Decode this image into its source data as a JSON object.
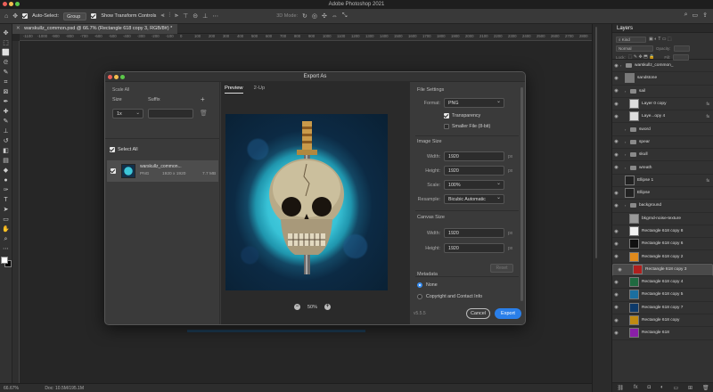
{
  "window_title": "Adobe Photoshop 2021",
  "options_bar": {
    "auto_select_label": "Auto-Select:",
    "auto_select_value": "Group",
    "transform_label": "Show Transform Controls",
    "mode_3d": "3D Mode:"
  },
  "document_tab": "warskullz_common.psd @ 66.7% (Rectangle 618 copy 3, RGB/8#) *",
  "ruler_ticks": [
    "-1100",
    "-1000",
    "-900",
    "-800",
    "-700",
    "-600",
    "-500",
    "-400",
    "-300",
    "-200",
    "-100",
    "0",
    "100",
    "200",
    "300",
    "400",
    "500",
    "600",
    "700",
    "800",
    "900",
    "1000",
    "1100",
    "1200",
    "1300",
    "1400",
    "1500",
    "1600",
    "1700",
    "1800",
    "1900",
    "2000",
    "2100",
    "2200",
    "2300",
    "2400",
    "2500",
    "2600",
    "2700",
    "2800",
    "2900",
    "3000"
  ],
  "status": {
    "zoom": "66.67%",
    "doc": "Doc: 10.5M/195.1M"
  },
  "dialog": {
    "title": "Export As",
    "scale_all": "Scale All",
    "size_header": "Size",
    "suffix_header": "Suffix",
    "scale_value": "1x",
    "select_all": "Select All",
    "asset": {
      "name": "warskullz_common...",
      "format": "PNG",
      "dimensions": "1920 x 1920",
      "filesize": "7.7 MB"
    },
    "tabs": [
      "Preview",
      "2-Up"
    ],
    "zoom": "50%",
    "file_settings": {
      "section": "File Settings",
      "format_label": "Format:",
      "format_value": "PNG",
      "transparency": "Transparency",
      "smaller_file": "Smaller File (8-bit)"
    },
    "image_size": {
      "section": "Image Size",
      "width_label": "Width:",
      "width_value": "1920",
      "height_label": "Height:",
      "height_value": "1920",
      "scale_label": "Scale:",
      "scale_value": "100%",
      "resample_label": "Resample:",
      "resample_value": "Bicubic Automatic",
      "unit": "px"
    },
    "canvas_size": {
      "section": "Canvas Size",
      "width_label": "Width:",
      "width_value": "1920",
      "height_label": "Height:",
      "height_value": "1920",
      "unit": "px",
      "reset": "Reset"
    },
    "metadata": {
      "section": "Metadata",
      "none": "None",
      "copyright": "Copyright and Contact Info"
    },
    "version": "v5.5.5",
    "cancel": "Cancel",
    "export": "Export"
  },
  "layers": {
    "title": "Layers",
    "kind": "Kind",
    "blend": "Normal",
    "opacity": "Opacity:",
    "lock": "Lock:",
    "fill": "Fill:",
    "items": [
      {
        "name": "warskullz_common_",
        "kind": "folder",
        "indent": 0,
        "eye": true
      },
      {
        "name": "sandstone",
        "kind": "layer",
        "indent": 1,
        "eye": true,
        "color": "#7a7a7a"
      },
      {
        "name": "sail",
        "kind": "folder",
        "indent": 1,
        "eye": true
      },
      {
        "name": "Layer 0 copy",
        "kind": "layer",
        "indent": 2,
        "eye": true,
        "color": "#dddddd",
        "fx": "fx"
      },
      {
        "name": "Laye...opy 4",
        "kind": "layer",
        "indent": 2,
        "eye": true,
        "color": "#dddddd",
        "fx": "fx"
      },
      {
        "name": "sword",
        "kind": "folder",
        "indent": 1,
        "eye": false
      },
      {
        "name": "spear",
        "kind": "folder",
        "indent": 1,
        "eye": true
      },
      {
        "name": "skull",
        "kind": "folder",
        "indent": 1,
        "eye": true
      },
      {
        "name": "wreath",
        "kind": "folder",
        "indent": 1,
        "eye": true
      },
      {
        "name": "Ellipse 1",
        "kind": "layer",
        "indent": 1,
        "eye": false,
        "color": "#222222",
        "fx": "fx"
      },
      {
        "name": "Ellipse",
        "kind": "layer",
        "indent": 1,
        "eye": true,
        "color": "#222222"
      },
      {
        "name": "background",
        "kind": "folder",
        "indent": 1,
        "eye": true
      },
      {
        "name": "bkgrnd-noise-texture",
        "kind": "layer",
        "indent": 2,
        "eye": false,
        "color": "#9a9a9a"
      },
      {
        "name": "Rectangle 618 copy 8",
        "kind": "layer",
        "indent": 2,
        "eye": true,
        "color": "#f2f2f2"
      },
      {
        "name": "Rectangle 618 copy 6",
        "kind": "layer",
        "indent": 2,
        "eye": true,
        "color": "#111111"
      },
      {
        "name": "Rectangle 618 copy 2",
        "kind": "layer",
        "indent": 2,
        "eye": true,
        "color": "#e08a1c"
      },
      {
        "name": "Rectangle 618 copy 3",
        "kind": "layer",
        "indent": 2,
        "eye": true,
        "color": "#b0201e",
        "selected": true
      },
      {
        "name": "Rectangle 618 copy 4",
        "kind": "layer",
        "indent": 2,
        "eye": true,
        "color": "#1f6a40"
      },
      {
        "name": "Rectangle 618 copy 5",
        "kind": "layer",
        "indent": 2,
        "eye": true,
        "color": "#1b6fa0"
      },
      {
        "name": "Rectangle 618 copy 7",
        "kind": "layer",
        "indent": 2,
        "eye": true,
        "color": "#0d3a6a"
      },
      {
        "name": "Rectangle 618 copy",
        "kind": "layer",
        "indent": 2,
        "eye": true,
        "color": "#c08a12"
      },
      {
        "name": "Rectangle 618",
        "kind": "layer",
        "indent": 2,
        "eye": true,
        "color": "#8a1fa8"
      }
    ]
  },
  "icons": {
    "tools": [
      "move-icon",
      "artboard-icon",
      "marquee-icon",
      "lasso-icon",
      "quick-select-icon",
      "crop-icon",
      "frame-icon",
      "eyedropper-icon",
      "healing-icon",
      "brush-icon",
      "stamp-icon",
      "history-brush-icon",
      "eraser-icon",
      "gradient-icon",
      "blur-icon",
      "dodge-icon",
      "pen-icon",
      "type-icon",
      "path-select-icon",
      "rectangle-icon",
      "hand-icon",
      "zoom-icon",
      "more-icon"
    ]
  }
}
